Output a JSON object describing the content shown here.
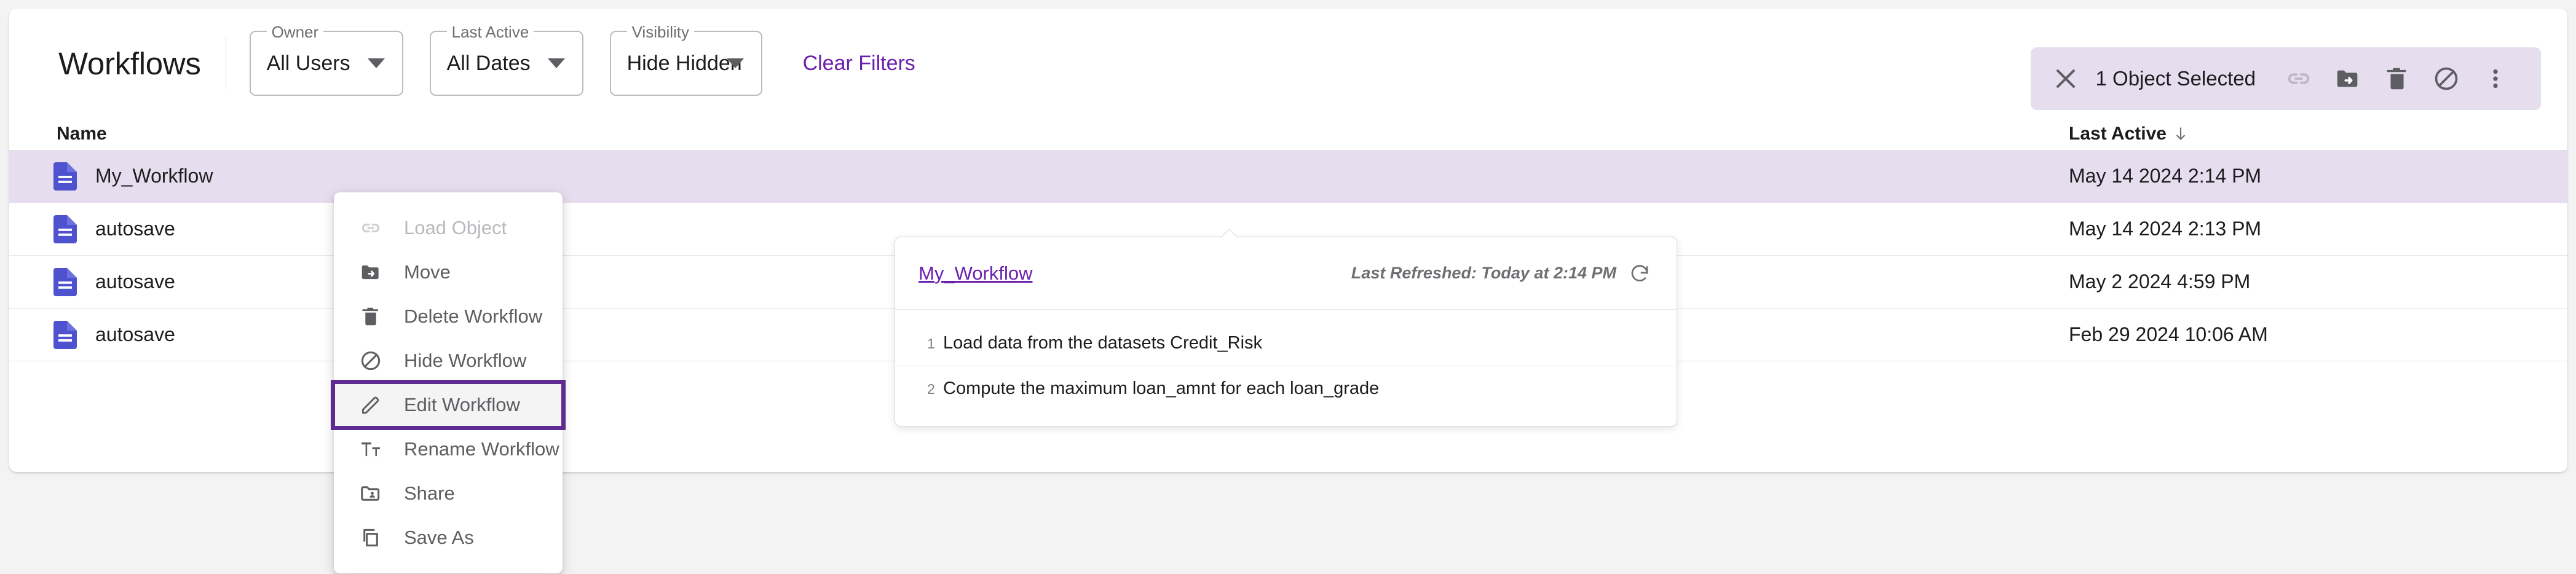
{
  "header": {
    "title": "Workflows",
    "filters": [
      {
        "label": "Owner",
        "value": "All Users"
      },
      {
        "label": "Last Active",
        "value": "All Dates"
      },
      {
        "label": "Visibility",
        "value": "Hide Hidden"
      }
    ],
    "clear_filters": "Clear Filters"
  },
  "selection_toolbar": {
    "count_label": "1 Object Selected",
    "actions": [
      {
        "name": "load-object",
        "icon": "link-icon",
        "disabled": true
      },
      {
        "name": "move",
        "icon": "folder-move-icon",
        "disabled": false
      },
      {
        "name": "delete",
        "icon": "trash-icon",
        "disabled": false
      },
      {
        "name": "hide",
        "icon": "circle-slash-icon",
        "disabled": false
      },
      {
        "name": "more",
        "icon": "vertical-dots-icon",
        "disabled": false
      }
    ]
  },
  "table": {
    "columns": {
      "name": "Name",
      "last_active": "Last Active"
    },
    "sort": "descending",
    "rows": [
      {
        "name": "My_Workflow",
        "last_active": "May 14 2024 2:14 PM",
        "selected": true
      },
      {
        "name": "autosave",
        "last_active": "May 14 2024 2:13 PM",
        "selected": false
      },
      {
        "name": "autosave",
        "last_active": "May 2 2024 4:59 PM",
        "selected": false
      },
      {
        "name": "autosave",
        "last_active": "Feb 29 2024 10:06 AM",
        "selected": false
      }
    ]
  },
  "context_menu": {
    "items": [
      {
        "label": "Load Object",
        "icon": "link-icon",
        "disabled": true,
        "highlighted": false
      },
      {
        "label": "Move",
        "icon": "folder-move-icon",
        "disabled": false,
        "highlighted": false
      },
      {
        "label": "Delete Workflow",
        "icon": "trash-icon",
        "disabled": false,
        "highlighted": false
      },
      {
        "label": "Hide Workflow",
        "icon": "circle-slash-icon",
        "disabled": false,
        "highlighted": false
      },
      {
        "label": "Edit Workflow",
        "icon": "pencil-icon",
        "disabled": false,
        "highlighted": true
      },
      {
        "label": "Rename Workflow",
        "icon": "text-format-icon",
        "disabled": false,
        "highlighted": false
      },
      {
        "label": "Share",
        "icon": "folder-share-icon",
        "disabled": false,
        "highlighted": false
      },
      {
        "label": "Save As",
        "icon": "copy-icon",
        "disabled": false,
        "highlighted": false
      }
    ]
  },
  "preview_popover": {
    "title": "My_Workflow",
    "last_refreshed": "Last Refreshed: Today at 2:14 PM",
    "refresh_icon": "refresh-icon",
    "steps": [
      {
        "num": "1",
        "text": "Load data from the datasets Credit_Risk"
      },
      {
        "num": "2",
        "text": "Compute the maximum loan_amnt for each loan_grade"
      }
    ]
  },
  "colors": {
    "accent_purple": "#6a1fae",
    "highlight_outline": "#5e2b91",
    "selected_row": "#e6ddee",
    "file_icon": "#4f52cf"
  }
}
